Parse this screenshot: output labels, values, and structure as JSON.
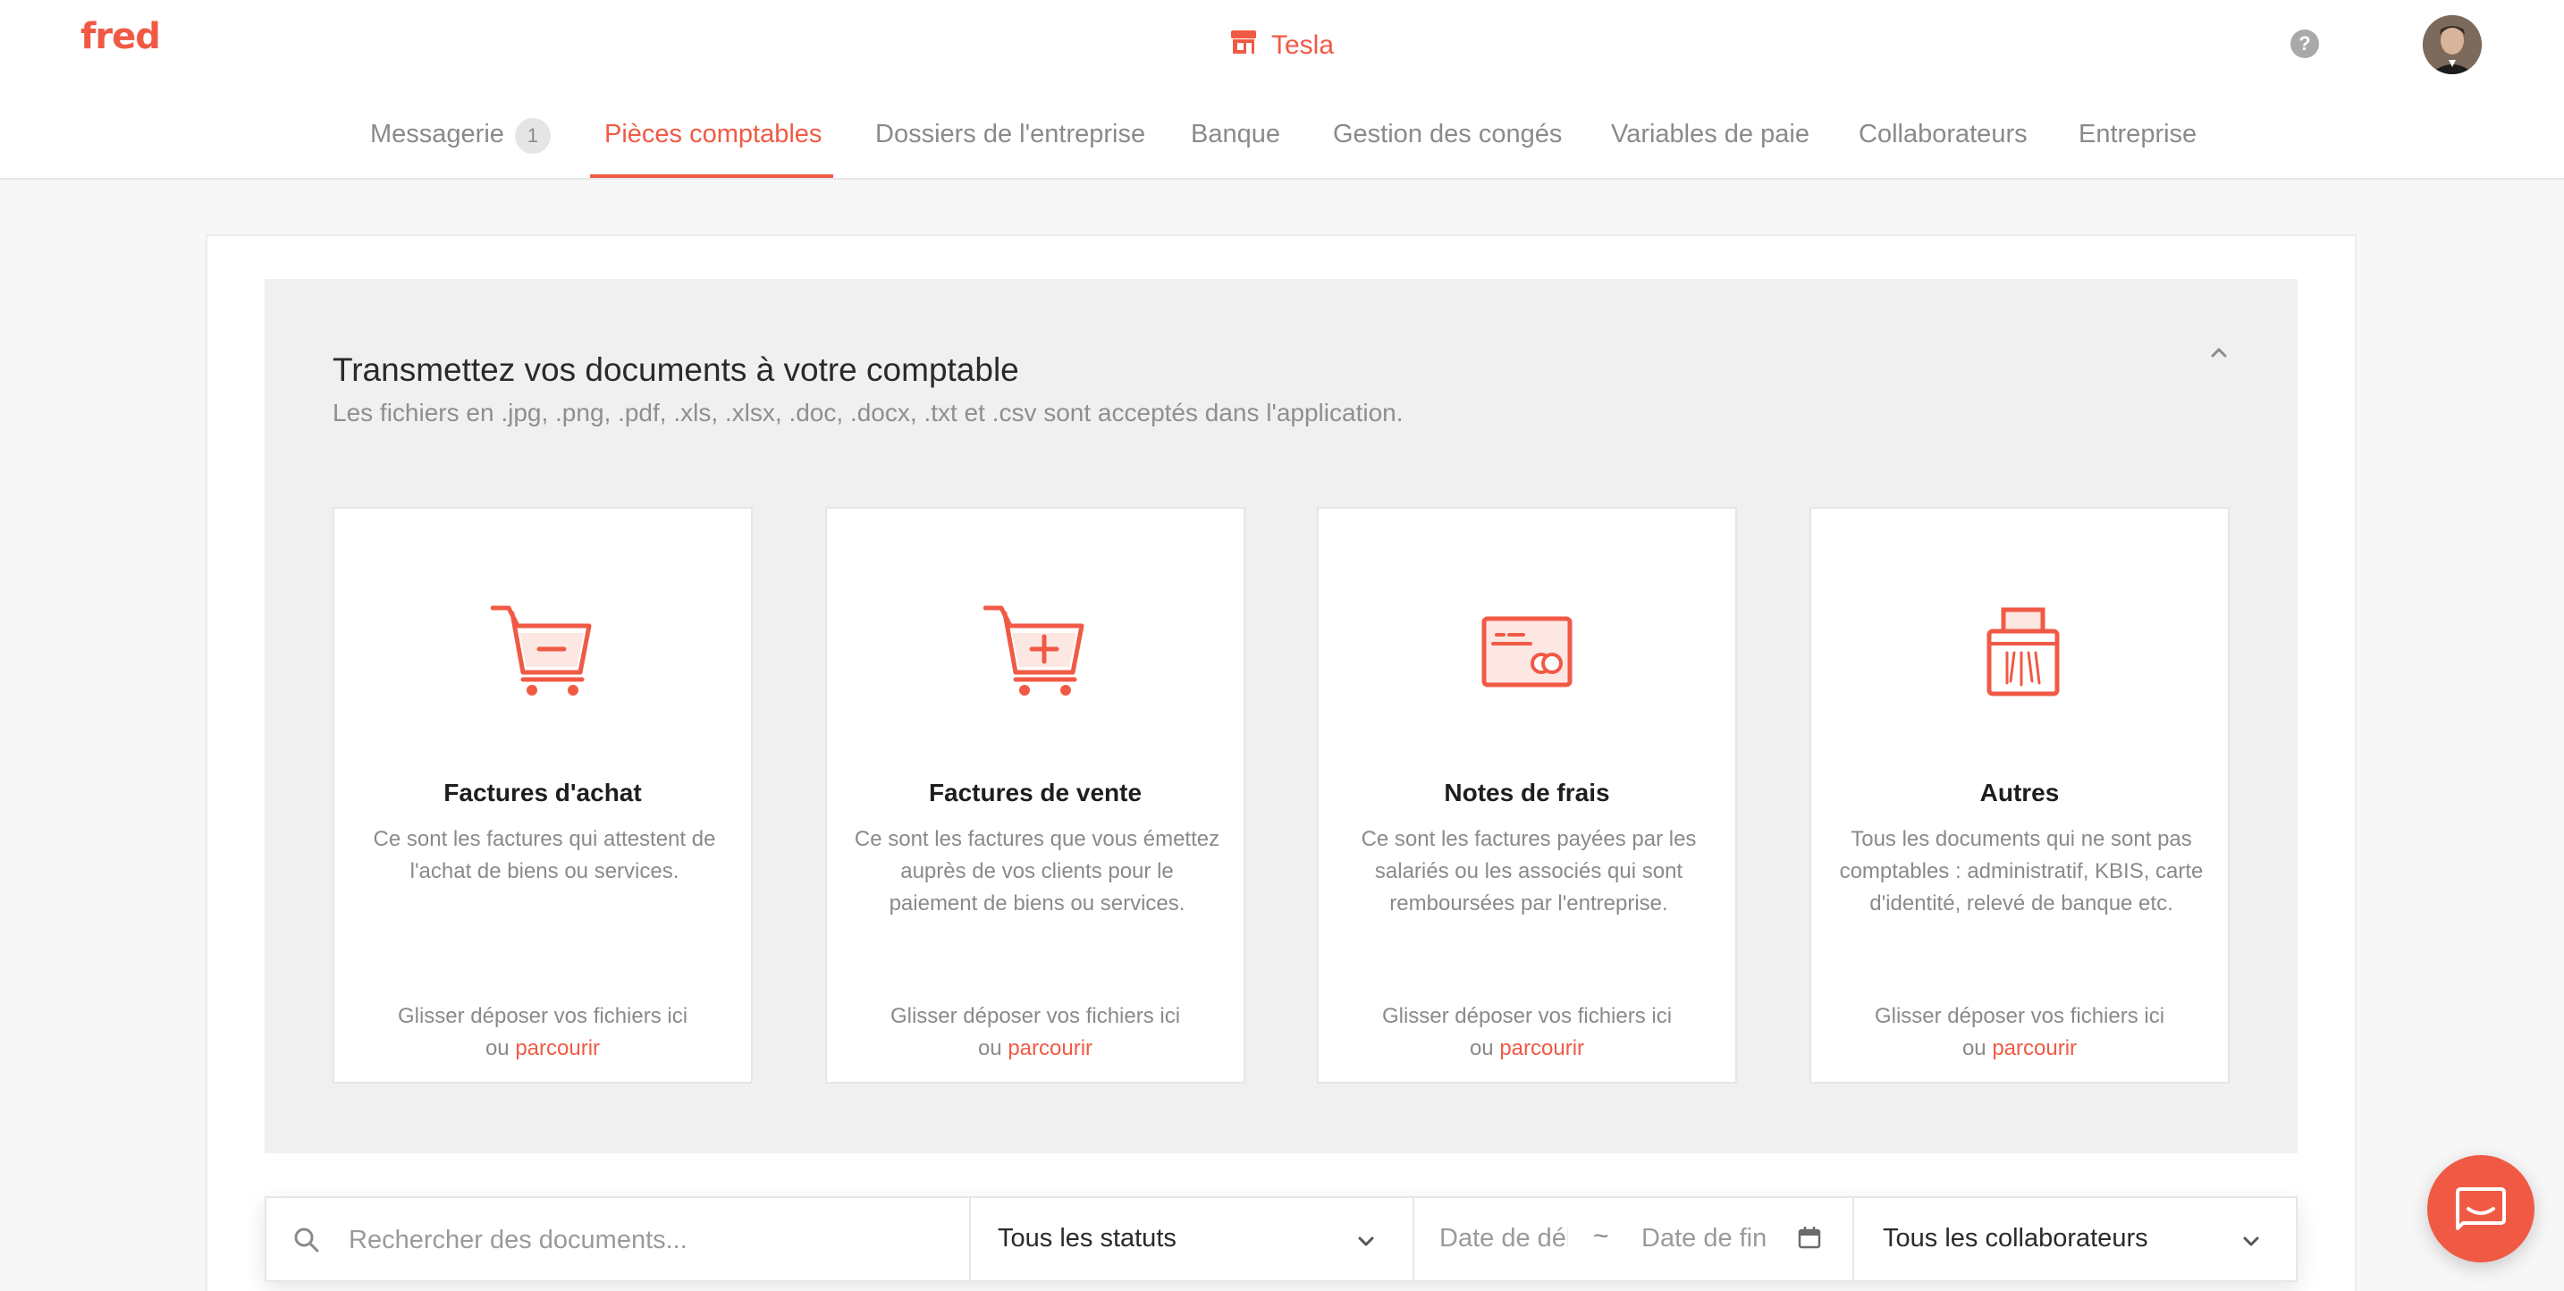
{
  "app": {
    "logo": "fred",
    "company": "Tesla",
    "help": "?"
  },
  "nav": {
    "items": [
      {
        "label": "Messagerie",
        "badge": "1"
      },
      {
        "label": "Pièces comptables"
      },
      {
        "label": "Dossiers de l'entreprise"
      },
      {
        "label": "Banque"
      },
      {
        "label": "Gestion des congés"
      },
      {
        "label": "Variables de paie"
      },
      {
        "label": "Collaborateurs"
      },
      {
        "label": "Entreprise"
      }
    ],
    "active_index": 1
  },
  "upload": {
    "title": "Transmettez vos documents à votre comptable",
    "subtitle": "Les fichiers en .jpg, .png, .pdf, .xls, .xlsx, .doc, .docx, .txt et .csv sont acceptés dans l'application.",
    "cards": [
      {
        "icon": "cart-minus-icon",
        "title": "Factures d'achat",
        "desc": "Ce sont les factures qui attestent de l'achat de biens ou services.",
        "drop": "Glisser déposer vos fichiers ici",
        "or": "ou",
        "browse": "parcourir"
      },
      {
        "icon": "cart-plus-icon",
        "title": "Factures de vente",
        "desc": "Ce sont les factures que vous émettez auprès de vos clients pour le paiement de biens ou services.",
        "drop": "Glisser déposer vos fichiers ici",
        "or": "ou",
        "browse": "parcourir"
      },
      {
        "icon": "credit-card-icon",
        "title": "Notes de frais",
        "desc": "Ce sont les factures payées par les salariés ou les associés qui sont remboursées par l'entreprise.",
        "drop": "Glisser déposer vos fichiers ici",
        "or": "ou",
        "browse": "parcourir"
      },
      {
        "icon": "shredder-icon",
        "title": "Autres",
        "desc": "Tous les documents qui ne sont pas comptables : administratif, KBIS, carte d'identité, relevé de banque etc.",
        "drop": "Glisser déposer vos fichiers ici",
        "or": "ou",
        "browse": "parcourir"
      }
    ]
  },
  "filters": {
    "search_placeholder": "Rechercher des documents...",
    "status_value": "Tous les statuts",
    "date_start_placeholder": "Date de début",
    "date_sep": "~",
    "date_end_placeholder": "Date de fin",
    "collaborators_value": "Tous les collaborateurs"
  },
  "colors": {
    "accent": "#f05a45",
    "muted": "#8a8a8a"
  }
}
